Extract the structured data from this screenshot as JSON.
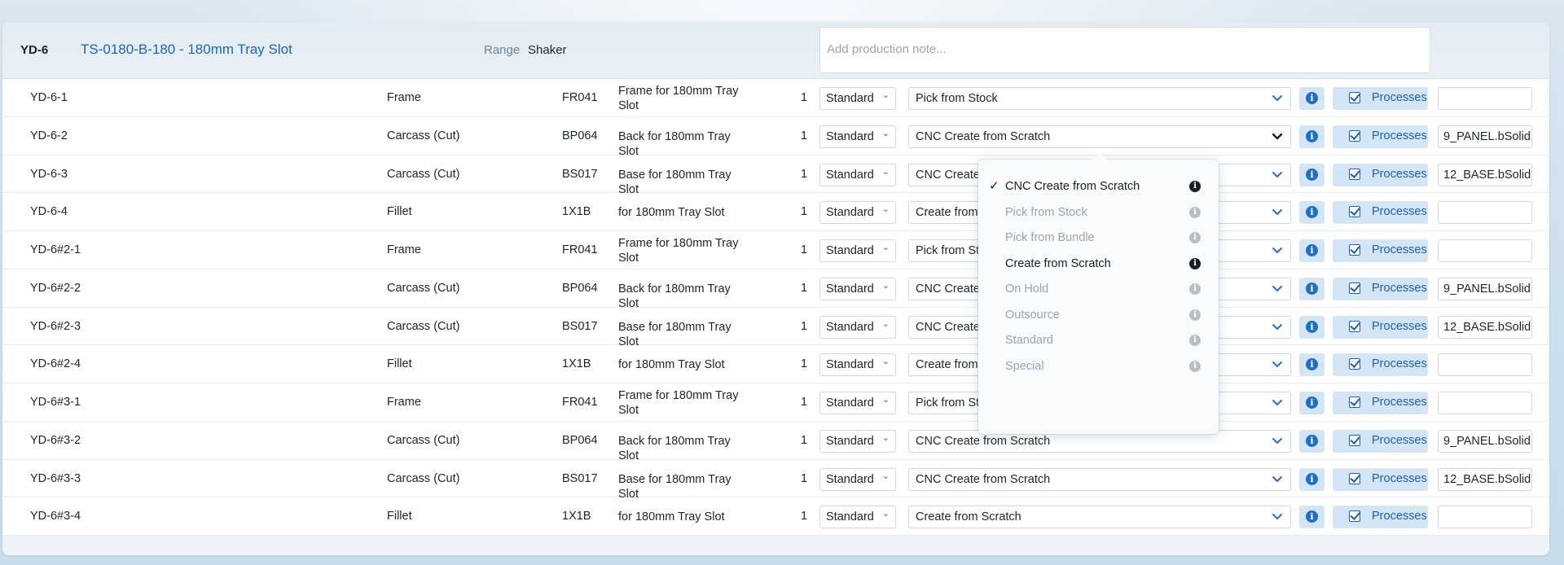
{
  "header": {
    "id": "YD-6",
    "title": "TS-0180-B-180 - 180mm Tray Slot",
    "range_label": "Range",
    "range_value": "Shaker",
    "note_placeholder": "Add production note..."
  },
  "labels": {
    "processes": "Processes",
    "info": "i"
  },
  "rows": [
    {
      "code": "YD-6-1",
      "type": "Frame",
      "part": "FR041",
      "desc": "Frame for 180mm Tray Slot",
      "qty": "1",
      "grade": "Standard",
      "method": "Pick from Stock",
      "file": ""
    },
    {
      "code": "YD-6-2",
      "type": "Carcass (Cut)",
      "part": "BP064",
      "desc": "Back for 180mm Tray Slot",
      "qty": "1",
      "grade": "Standard",
      "method": "CNC Create from Scratch",
      "file": "9_PANEL.bSolid"
    },
    {
      "code": "YD-6-3",
      "type": "Carcass (Cut)",
      "part": "BS017",
      "desc": "Base for 180mm Tray Slot",
      "qty": "1",
      "grade": "Standard",
      "method": "CNC Create f",
      "file": "12_BASE.bSolid"
    },
    {
      "code": "YD-6-4",
      "type": "Fillet",
      "part": "1X1B",
      "desc": " for 180mm Tray Slot",
      "qty": "1",
      "grade": "Standard",
      "method": "Create from S",
      "file": ""
    },
    {
      "code": "YD-6#2-1",
      "type": "Frame",
      "part": "FR041",
      "desc": "Frame for 180mm Tray Slot",
      "qty": "1",
      "grade": "Standard",
      "method": "Pick from Sto",
      "file": ""
    },
    {
      "code": "YD-6#2-2",
      "type": "Carcass (Cut)",
      "part": "BP064",
      "desc": "Back for 180mm Tray Slot",
      "qty": "1",
      "grade": "Standard",
      "method": "CNC Create f",
      "file": "9_PANEL.bSolid"
    },
    {
      "code": "YD-6#2-3",
      "type": "Carcass (Cut)",
      "part": "BS017",
      "desc": "Base for 180mm Tray Slot",
      "qty": "1",
      "grade": "Standard",
      "method": "CNC Create f",
      "file": "12_BASE.bSolid"
    },
    {
      "code": "YD-6#2-4",
      "type": "Fillet",
      "part": "1X1B",
      "desc": " for 180mm Tray Slot",
      "qty": "1",
      "grade": "Standard",
      "method": "Create from S",
      "file": ""
    },
    {
      "code": "YD-6#3-1",
      "type": "Frame",
      "part": "FR041",
      "desc": "Frame for 180mm Tray Slot",
      "qty": "1",
      "grade": "Standard",
      "method": "Pick from Sto",
      "file": ""
    },
    {
      "code": "YD-6#3-2",
      "type": "Carcass (Cut)",
      "part": "BP064",
      "desc": "Back for 180mm Tray Slot",
      "qty": "1",
      "grade": "Standard",
      "method": "CNC Create from Scratch",
      "file": "9_PANEL.bSolid"
    },
    {
      "code": "YD-6#3-3",
      "type": "Carcass (Cut)",
      "part": "BS017",
      "desc": "Base for 180mm Tray Slot",
      "qty": "1",
      "grade": "Standard",
      "method": "CNC Create from Scratch",
      "file": "12_BASE.bSolid"
    },
    {
      "code": "YD-6#3-4",
      "type": "Fillet",
      "part": "1X1B",
      "desc": " for 180mm Tray Slot",
      "qty": "1",
      "grade": "Standard",
      "method": "Create from Scratch",
      "file": ""
    }
  ],
  "dropdown": {
    "selected": "CNC Create from Scratch",
    "options": [
      {
        "label": "CNC Create from Scratch",
        "state": "active",
        "checked": true
      },
      {
        "label": "Pick from Stock",
        "state": "muted",
        "checked": false
      },
      {
        "label": "Pick from Bundle",
        "state": "muted",
        "checked": false
      },
      {
        "label": "Create from Scratch",
        "state": "active",
        "checked": false
      },
      {
        "label": "On Hold",
        "state": "muted",
        "checked": false
      },
      {
        "label": "Outsource",
        "state": "muted",
        "checked": false
      },
      {
        "label": "Standard",
        "state": "muted",
        "checked": false
      },
      {
        "label": "Special",
        "state": "muted",
        "checked": false
      }
    ]
  },
  "colors": {
    "accent": "#1f6fc4",
    "title": "#1a62c4",
    "button_bg": "#d4e6f6",
    "muted_text": "#9aa4ae"
  },
  "icons": {
    "chevron": "chevron-down-icon",
    "info": "info-icon",
    "check": "checkbox-checked-icon",
    "selected": "checkmark-icon"
  }
}
